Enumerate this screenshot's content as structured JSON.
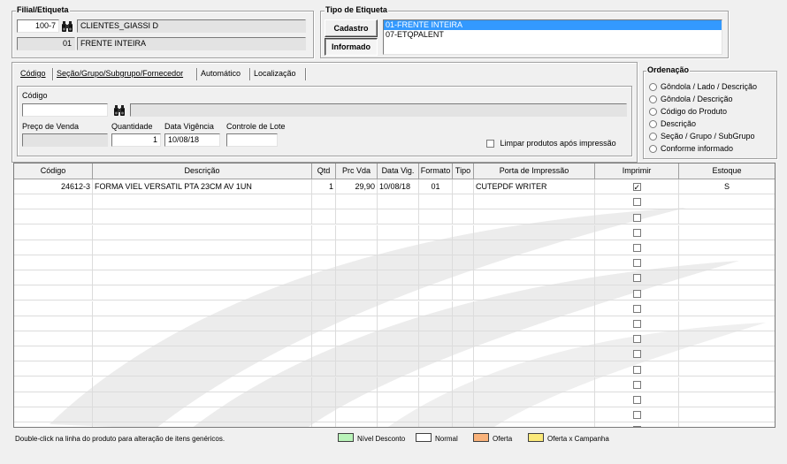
{
  "filial": {
    "title": "Filial/Etiqueta",
    "code": "100-7",
    "name": "CLIENTES_GIASSI D",
    "label_code": "01",
    "label_name": "FRENTE INTEIRA"
  },
  "tipo": {
    "title": "Tipo de Etiqueta",
    "cadastro_label": "Cadastro",
    "informado_label": "Informado",
    "options": [
      "01-FRENTE INTEIRA",
      "07-ETQPALENT"
    ],
    "selected_index": 0
  },
  "tabs": [
    "Código",
    "Seção/Grupo/Subgrupo/Fornecedor",
    "Automático",
    "Localização"
  ],
  "form": {
    "codigo_label": "Código",
    "codigo_value": "",
    "preco_label": "Preço de Venda",
    "preco_value": "",
    "quantidade_label": "Quantidade",
    "quantidade_value": "1",
    "vigencia_label": "Data Vigência",
    "vigencia_value": "10/08/18",
    "lote_label": "Controle de Lote",
    "lote_value": "",
    "limpar_label": "Limpar produtos após impressão"
  },
  "ordenacao": {
    "title": "Ordenação",
    "options": [
      "Gôndola / Lado / Descrição",
      "Gôndola / Descrição",
      "Código do Produto",
      "Descrição",
      "Seção / Grupo / SubGrupo",
      "Conforme informado"
    ]
  },
  "table": {
    "headers": [
      "Código",
      "Descrição",
      "Qtd",
      "Prc Vda",
      "Data Vig.",
      "Formato",
      "Tipo",
      "Porta de Impressão",
      "Imprimir",
      "Estoque"
    ],
    "rows": [
      {
        "codigo": "24612-3",
        "descricao": "FORMA VIEL VERSATIL PTA 23CM   AV   1UN",
        "qtd": "1",
        "prc": "29,90",
        "data": "10/08/18",
        "formato": "01",
        "tipo": "",
        "porta": "CUTEPDF WRITER",
        "imprimir": true,
        "estoque": "S"
      }
    ],
    "empty_rows": 16
  },
  "footer": {
    "hint": "Double-click na linha do produto para alteração de itens genéricos.",
    "legend": [
      {
        "label": "Nível Desconto",
        "color": "#b9f3b9"
      },
      {
        "label": "Normal",
        "color": "#ffffff"
      },
      {
        "label": "Oferta",
        "color": "#f9b27a"
      },
      {
        "label": "Oferta x Campanha",
        "color": "#fbe97a"
      }
    ]
  }
}
